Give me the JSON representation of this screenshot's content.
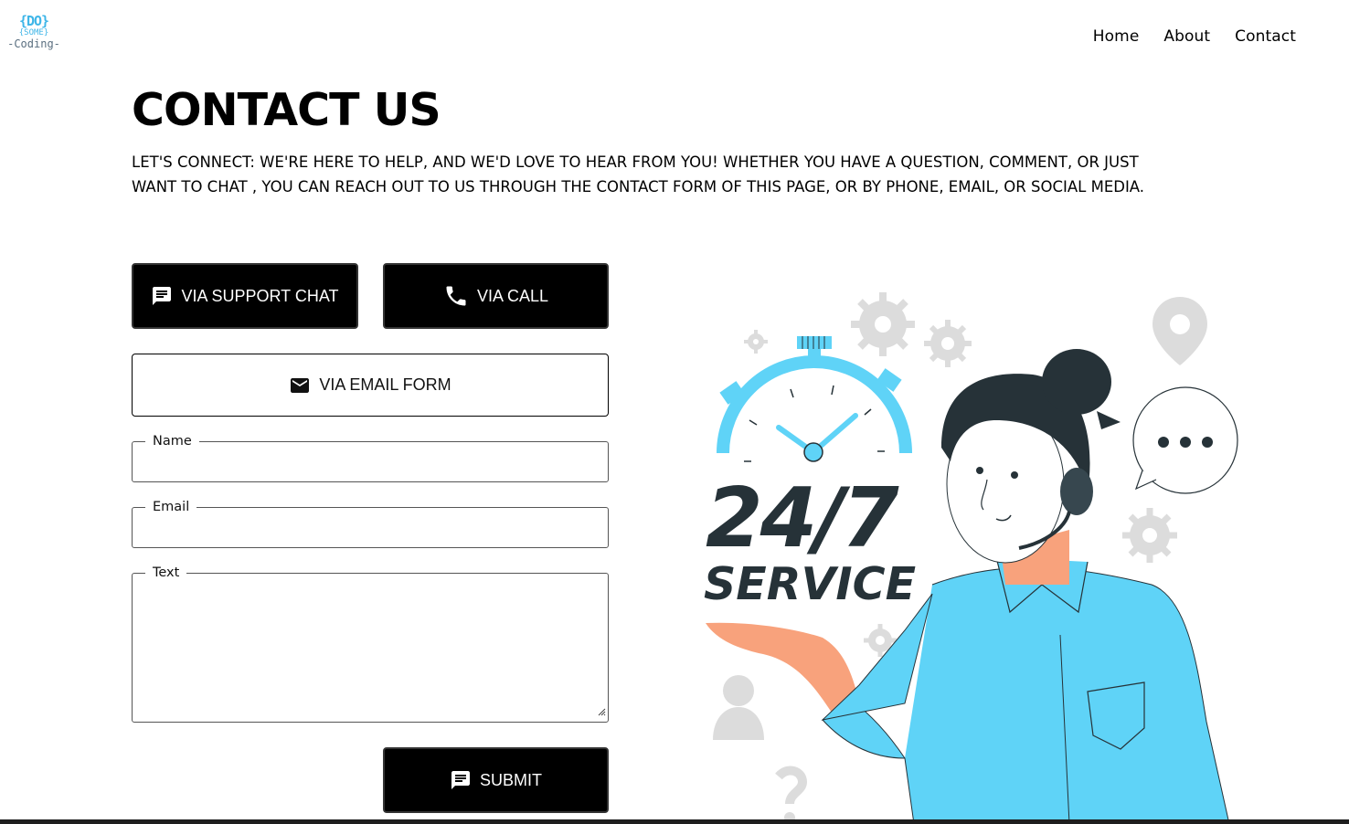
{
  "logo": {
    "line1_brace_open": "{",
    "line1_text": "DO",
    "line1_brace_close": "}",
    "line2_brace_open": "{",
    "line2_text": "SOME",
    "line2_brace_close": "}",
    "line3_text": "-Coding-"
  },
  "nav": {
    "home": "Home",
    "about": "About",
    "contact": "Contact"
  },
  "page": {
    "title": "CONTACT US",
    "intro": "LET'S CONNECT: WE'RE HERE TO HELP, AND WE'D LOVE TO HEAR FROM YOU! WHETHER YOU HAVE A QUESTION, COMMENT, OR JUST WANT TO CHAT , YOU CAN REACH OUT TO US THROUGH THE CONTACT FORM OF THIS PAGE, OR BY PHONE, EMAIL, OR SOCIAL MEDIA."
  },
  "buttons": {
    "chat": "VIA SUPPORT CHAT",
    "call": "VIA CALL",
    "email": "VIA EMAIL FORM",
    "submit": "SUBMIT"
  },
  "form": {
    "name_label": "Name",
    "name_value": "",
    "email_label": "Email",
    "email_value": "",
    "text_label": "Text",
    "text_value": ""
  },
  "illustration": {
    "big_text": "24/7",
    "sub_text": "SERVICE"
  },
  "colors": {
    "accent": "#5fd3f7",
    "dark": "#263238",
    "button": "#000000"
  }
}
